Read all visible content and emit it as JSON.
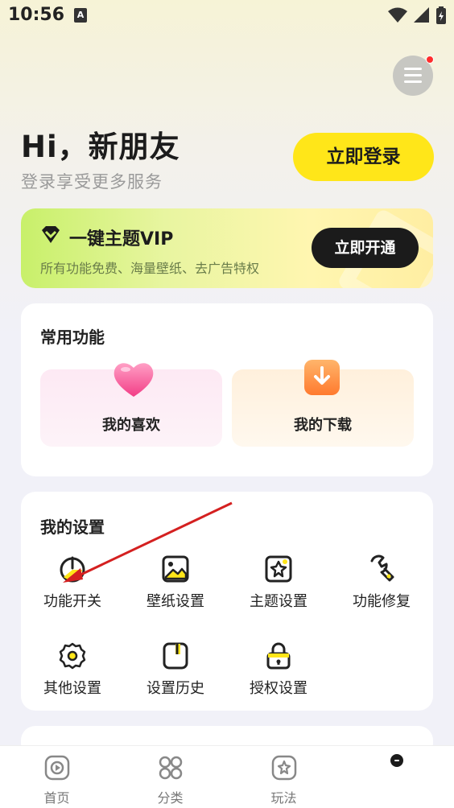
{
  "status_bar": {
    "time": "10:56",
    "notification_badge": "A"
  },
  "header": {
    "greeting": "Hi，新朋友",
    "subtitle": "登录享受更多服务",
    "login_button": "立即登录"
  },
  "vip": {
    "title": "一键主题VIP",
    "description": "所有功能免费、海量壁纸、去广告特权",
    "button": "立即开通"
  },
  "common_functions": {
    "title": "常用功能",
    "items": [
      {
        "label": "我的喜欢",
        "icon": "heart-icon"
      },
      {
        "label": "我的下载",
        "icon": "download-icon"
      }
    ]
  },
  "settings": {
    "title": "我的设置",
    "items": [
      {
        "label": "功能开关",
        "icon": "power-icon"
      },
      {
        "label": "壁纸设置",
        "icon": "image-icon"
      },
      {
        "label": "主题设置",
        "icon": "theme-icon"
      },
      {
        "label": "功能修复",
        "icon": "wrench-icon"
      },
      {
        "label": "其他设置",
        "icon": "gear-icon"
      },
      {
        "label": "设置历史",
        "icon": "history-icon"
      },
      {
        "label": "授权设置",
        "icon": "lock-icon"
      }
    ]
  },
  "bottom_nav": [
    {
      "label": "首页",
      "icon": "play-icon"
    },
    {
      "label": "分类",
      "icon": "grid-icon"
    },
    {
      "label": "玩法",
      "icon": "puzzle-icon"
    },
    {
      "label": "",
      "icon": "profile-icon"
    }
  ],
  "colors": {
    "accent_yellow": "#ffe619",
    "dark": "#1b1b1b",
    "annotation_arrow": "#d42020"
  }
}
